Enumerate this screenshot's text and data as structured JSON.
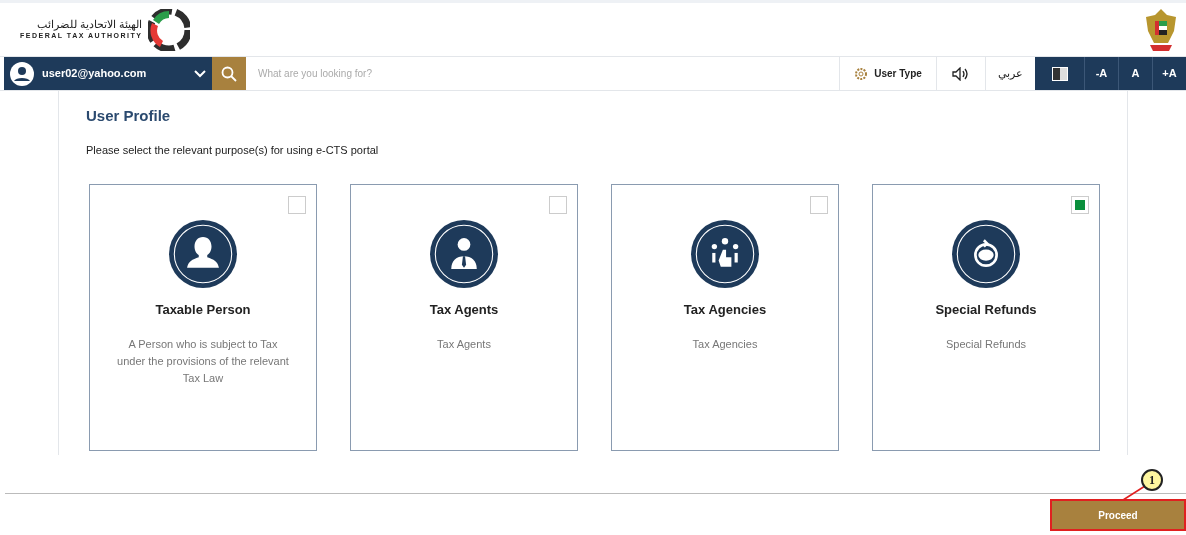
{
  "header": {
    "logo_arabic": "الهيئة الاتحادية للضرائب",
    "logo_english": "FEDERAL TAX AUTHORITY"
  },
  "nav": {
    "user": "user02@yahoo.com",
    "search_placeholder": "What are you looking for?",
    "user_type": "User Type",
    "language": "عربي",
    "font_buttons": [
      "-A",
      "A",
      "+A"
    ]
  },
  "profile": {
    "title": "User Profile",
    "instruction": "Please select the relevant purpose(s) for using e-CTS portal",
    "cards": [
      {
        "kind": "person",
        "title": "Taxable Person",
        "description": "A Person who is subject to Tax under the provisions of the relevant Tax Law",
        "checked": false
      },
      {
        "kind": "agent",
        "title": "Tax Agents",
        "description": "Tax Agents",
        "checked": false
      },
      {
        "kind": "agency",
        "title": "Tax Agencies",
        "description": "Tax Agencies",
        "checked": false
      },
      {
        "kind": "refund",
        "title": "Special Refunds",
        "description": "Special Refunds",
        "checked": true
      }
    ]
  },
  "footer": {
    "proceed": "Proceed",
    "callout": "1"
  }
}
